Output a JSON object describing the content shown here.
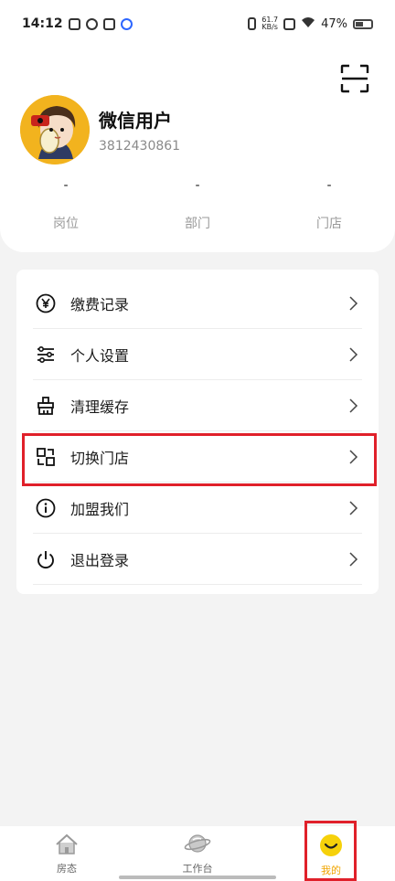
{
  "status_bar": {
    "time": "14:12",
    "net_speed_value": "61.7",
    "net_speed_unit": "KB/s",
    "battery_pct": "47%"
  },
  "profile": {
    "name": "微信用户",
    "id": "3812430861"
  },
  "stats": [
    {
      "value": "-",
      "label": "岗位"
    },
    {
      "value": "-",
      "label": "部门"
    },
    {
      "value": "-",
      "label": "门店"
    }
  ],
  "menu": [
    {
      "label": "缴费记录",
      "icon": "yen-icon"
    },
    {
      "label": "个人设置",
      "icon": "sliders-icon"
    },
    {
      "label": "清理缓存",
      "icon": "broom-icon"
    },
    {
      "label": "切换门店",
      "icon": "switch-store-icon"
    },
    {
      "label": "加盟我们",
      "icon": "info-icon"
    },
    {
      "label": "退出登录",
      "icon": "power-icon"
    }
  ],
  "nav": [
    {
      "label": "房态",
      "icon": "house-icon"
    },
    {
      "label": "工作台",
      "icon": "planet-icon"
    },
    {
      "label": "我的",
      "icon": "smile-icon",
      "active": true
    }
  ],
  "colors": {
    "accent": "#f0a500",
    "highlight": "#e0202a"
  }
}
